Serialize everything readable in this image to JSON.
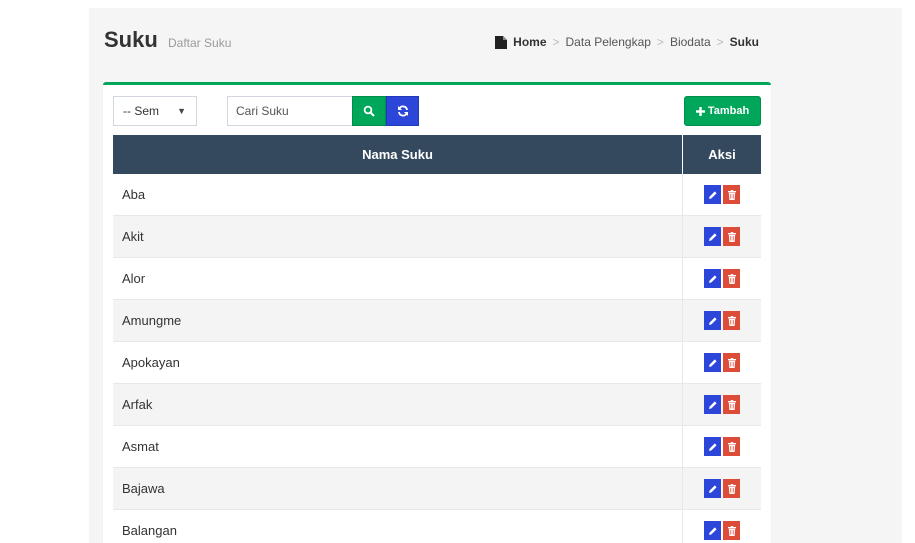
{
  "header": {
    "title": "Suku",
    "subtitle": "Daftar Suku",
    "breadcrumb": {
      "home": "Home",
      "items": [
        "Data Pelengkap",
        "Biodata"
      ],
      "active": "Suku",
      "separator": ">"
    }
  },
  "toolbar": {
    "filter_value": "-- Sem",
    "search_placeholder": "Cari Suku",
    "add_label": "Tambah",
    "add_icon": "plus-icon",
    "search_icon": "search-icon",
    "refresh_icon": "refresh-icon"
  },
  "table": {
    "columns": [
      "Nama Suku",
      "Aksi"
    ],
    "rows": [
      {
        "name": "Aba"
      },
      {
        "name": "Akit"
      },
      {
        "name": "Alor"
      },
      {
        "name": "Amungme"
      },
      {
        "name": "Apokayan"
      },
      {
        "name": "Arfak"
      },
      {
        "name": "Asmat"
      },
      {
        "name": "Bajawa"
      },
      {
        "name": "Balangan"
      }
    ],
    "edit_icon": "pencil-icon",
    "delete_icon": "trash-icon"
  },
  "colors": {
    "accent_green": "#00a65a",
    "accent_blue": "#2b46d8",
    "danger_red": "#dd4b39",
    "table_header": "#34495e"
  }
}
